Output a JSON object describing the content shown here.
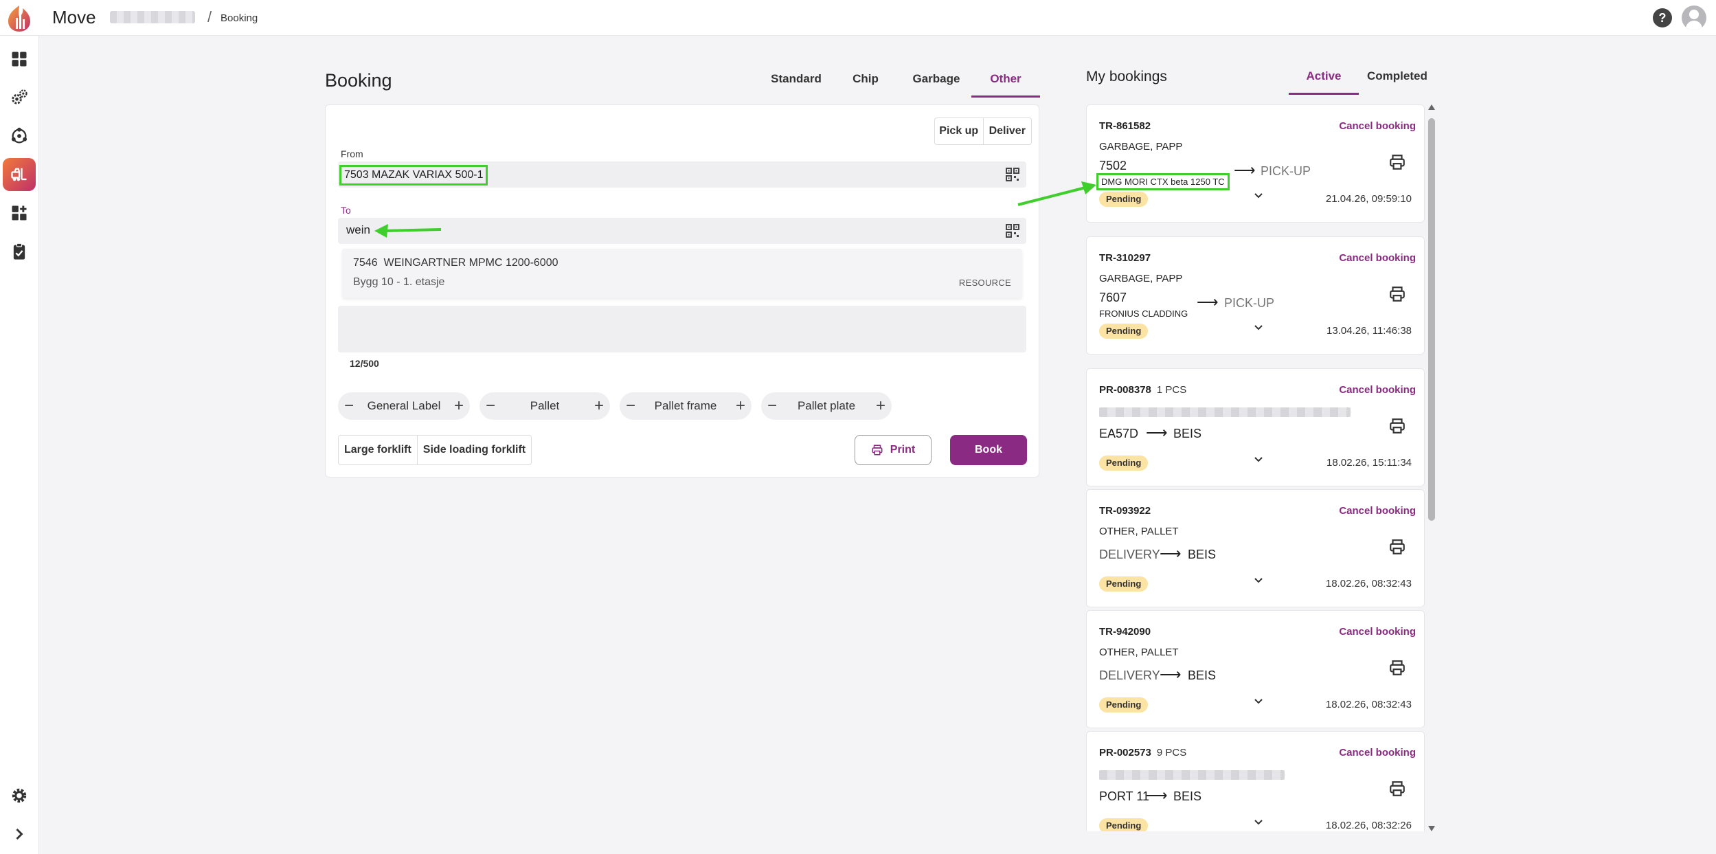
{
  "app": {
    "title": "Move",
    "breadcrumb_current": "Booking"
  },
  "sidebar": {
    "items": [
      {
        "name": "dashboard",
        "icon": "dashboard-icon"
      },
      {
        "name": "settings-cogs",
        "icon": "cogs-icon"
      },
      {
        "name": "network",
        "icon": "network-icon"
      },
      {
        "name": "forklift",
        "icon": "forklift-icon",
        "active": true
      },
      {
        "name": "widgets",
        "icon": "add-widget-icon"
      },
      {
        "name": "clipboard",
        "icon": "clipboard-icon"
      }
    ],
    "bottom": [
      {
        "icon": "gear-icon"
      },
      {
        "icon": "chevron-right-icon"
      }
    ]
  },
  "booking": {
    "title": "Booking",
    "tabs": [
      "Standard",
      "Chip",
      "Garbage",
      "Other"
    ],
    "active_tab": "Other",
    "direction": [
      "Pick up",
      "Deliver"
    ],
    "from_label": "From",
    "from_value": "7503 MAZAK VARIAX 500-1",
    "to_label": "To",
    "to_value": "wein",
    "suggestion": {
      "code": "7546",
      "name": "WEINGARTNER MPMC 1200-6000",
      "location": "Bygg 10 - 1. etasje",
      "tag": "RESOURCE"
    },
    "char_counter": "12/500",
    "steppers": [
      "General Label",
      "Pallet",
      "Pallet frame",
      "Pallet plate"
    ],
    "forklifts": [
      "Large forklift",
      "Side loading forklift"
    ],
    "print_label": "Print",
    "book_label": "Book"
  },
  "my_bookings": {
    "title": "My bookings",
    "tabs": [
      "Active",
      "Completed"
    ],
    "active_tab": "Active",
    "cancel_label": "Cancel booking",
    "items": [
      {
        "id": "TR-861582",
        "pcs": "",
        "type": "GARBAGE, PAPP",
        "from": "7502",
        "from_sub": "DMG MORI CTX beta 1250 TC",
        "to": "PICK-UP",
        "status": "Pending",
        "time": "21.04.26, 09:59:10"
      },
      {
        "id": "TR-310297",
        "pcs": "",
        "type": "GARBAGE, PAPP",
        "from": "7607",
        "from_sub": "FRONIUS CLADDING",
        "to": "PICK-UP",
        "status": "Pending",
        "time": "13.04.26, 11:46:38"
      },
      {
        "id": "PR-008378",
        "pcs": "1 PCS",
        "type": "",
        "from": "EA57D",
        "from_sub": "",
        "to": "BEIS",
        "status": "Pending",
        "time": "18.02.26, 15:11:34"
      },
      {
        "id": "TR-093922",
        "pcs": "",
        "type": "OTHER, PALLET",
        "from": "DELIVERY",
        "from_sub": "",
        "to": "BEIS",
        "status": "Pending",
        "time": "18.02.26, 08:32:43"
      },
      {
        "id": "TR-942090",
        "pcs": "",
        "type": "OTHER, PALLET",
        "from": "DELIVERY",
        "from_sub": "",
        "to": "BEIS",
        "status": "Pending",
        "time": "18.02.26, 08:32:43"
      },
      {
        "id": "PR-002573",
        "pcs": "9 PCS",
        "type": "",
        "from": "PORT 11",
        "from_sub": "",
        "to": "BEIS",
        "status": "Pending",
        "time": "18.02.26, 08:32:26"
      }
    ]
  },
  "colors": {
    "accent": "#8a2a82",
    "pending": "#fbe3a4",
    "annotation": "#3fce2c"
  }
}
